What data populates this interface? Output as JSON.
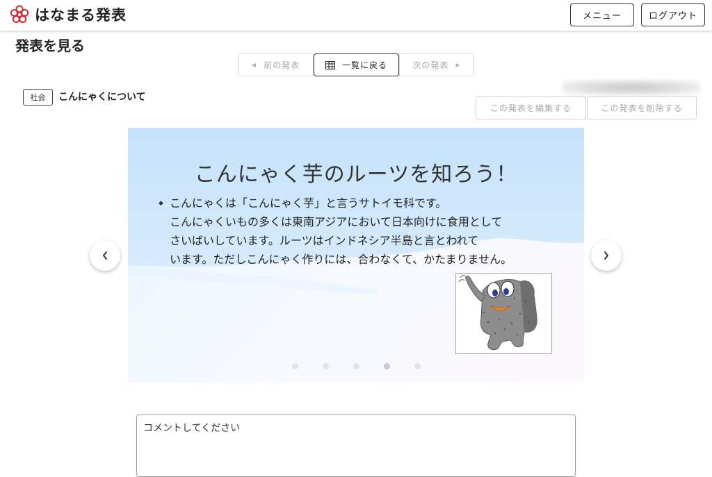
{
  "header": {
    "app_name": "はなまる発表",
    "logo_icon": "flower-icon",
    "menu_label": "メニュー",
    "logout_label": "ログアウト"
  },
  "page": {
    "title": "発表を見る"
  },
  "nav": {
    "prev_label": "前の発表",
    "list_label": "一覧に戻る",
    "next_label": "次の発表"
  },
  "presentation": {
    "category": "社会",
    "title": "こんにゃくについて",
    "edit_label": "この発表を編集する",
    "delete_label": "この発表を削除する"
  },
  "slide": {
    "heading": "こんにゃく芋のルーツを知ろう！",
    "lines": [
      "こんにゃくは「こんにゃく芋」と言うサトイモ科です。",
      "こんにゃくいもの多くは東南アジアにおいて日本向けに食用として",
      "さいばいしています。ルーツはインドネシア半島と言とわれて",
      "います。ただしこんにゃく作りには、合わなくて、かたまりません。"
    ],
    "illustration_icon": "konnyaku-character-illustration",
    "slide_count": 5,
    "current_slide": 4
  },
  "comment": {
    "placeholder": "コメントしてください"
  },
  "colors": {
    "accent_red": "#d9262d",
    "slide_sky": "#cfe6fb"
  }
}
